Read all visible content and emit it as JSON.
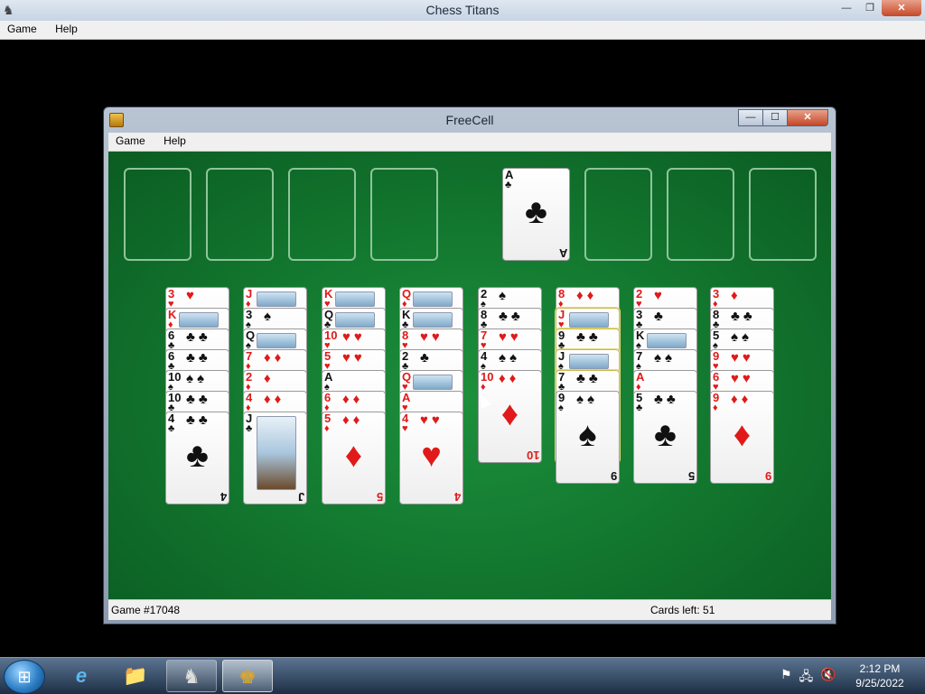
{
  "bg_window": {
    "title": "Chess Titans",
    "menu": [
      "Game",
      "Help"
    ],
    "controls": {
      "minimize": "—",
      "restore": "❐",
      "close": "✕"
    }
  },
  "freecell": {
    "title": "FreeCell",
    "menu": [
      "Game",
      "Help"
    ],
    "controls": {
      "minimize": "—",
      "maximize": "☐",
      "close": "✕"
    },
    "foundation": [
      {
        "rank": "A",
        "suit": "♣",
        "color": "black"
      }
    ],
    "columns": [
      [
        {
          "r": "3",
          "s": "♥",
          "c": "red"
        },
        {
          "r": "K",
          "s": "♦",
          "c": "red"
        },
        {
          "r": "6",
          "s": "♣",
          "c": "black"
        },
        {
          "r": "6",
          "s": "♣",
          "c": "black"
        },
        {
          "r": "10",
          "s": "♠",
          "c": "black"
        },
        {
          "r": "10",
          "s": "♣",
          "c": "black"
        },
        {
          "r": "4",
          "s": "♣",
          "c": "black"
        }
      ],
      [
        {
          "r": "J",
          "s": "♦",
          "c": "red"
        },
        {
          "r": "3",
          "s": "♠",
          "c": "black"
        },
        {
          "r": "Q",
          "s": "♠",
          "c": "black"
        },
        {
          "r": "7",
          "s": "♦",
          "c": "red"
        },
        {
          "r": "2",
          "s": "♦",
          "c": "red"
        },
        {
          "r": "4",
          "s": "♦",
          "c": "red"
        },
        {
          "r": "J",
          "s": "♣",
          "c": "black"
        }
      ],
      [
        {
          "r": "K",
          "s": "♥",
          "c": "red"
        },
        {
          "r": "Q",
          "s": "♣",
          "c": "black"
        },
        {
          "r": "10",
          "s": "♥",
          "c": "red"
        },
        {
          "r": "5",
          "s": "♥",
          "c": "red"
        },
        {
          "r": "A",
          "s": "♠",
          "c": "black"
        },
        {
          "r": "6",
          "s": "♦",
          "c": "red"
        },
        {
          "r": "5",
          "s": "♦",
          "c": "red"
        }
      ],
      [
        {
          "r": "Q",
          "s": "♦",
          "c": "red"
        },
        {
          "r": "K",
          "s": "♣",
          "c": "black"
        },
        {
          "r": "8",
          "s": "♥",
          "c": "red"
        },
        {
          "r": "2",
          "s": "♣",
          "c": "black"
        },
        {
          "r": "Q",
          "s": "♥",
          "c": "red"
        },
        {
          "r": "A",
          "s": "♥",
          "c": "red"
        },
        {
          "r": "4",
          "s": "♥",
          "c": "red"
        }
      ],
      [
        {
          "r": "2",
          "s": "♠",
          "c": "black"
        },
        {
          "r": "8",
          "s": "♣",
          "c": "black"
        },
        {
          "r": "7",
          "s": "♥",
          "c": "red"
        },
        {
          "r": "4",
          "s": "♠",
          "c": "black"
        },
        {
          "r": "10",
          "s": "♦",
          "c": "red"
        }
      ],
      [
        {
          "r": "8",
          "s": "♦",
          "c": "red"
        },
        {
          "r": "J",
          "s": "♥",
          "c": "red"
        },
        {
          "r": "9",
          "s": "♣",
          "c": "black"
        },
        {
          "r": "J",
          "s": "♠",
          "c": "black"
        },
        {
          "r": "7",
          "s": "♣",
          "c": "black"
        },
        {
          "r": "9",
          "s": "♠",
          "c": "black"
        }
      ],
      [
        {
          "r": "2",
          "s": "♥",
          "c": "red"
        },
        {
          "r": "3",
          "s": "♣",
          "c": "black"
        },
        {
          "r": "K",
          "s": "♠",
          "c": "black"
        },
        {
          "r": "7",
          "s": "♠",
          "c": "black"
        },
        {
          "r": "A",
          "s": "♦",
          "c": "red"
        },
        {
          "r": "5",
          "s": "♣",
          "c": "black"
        }
      ],
      [
        {
          "r": "3",
          "s": "♦",
          "c": "red"
        },
        {
          "r": "8",
          "s": "♣",
          "c": "black"
        },
        {
          "r": "5",
          "s": "♠",
          "c": "black"
        },
        {
          "r": "9",
          "s": "♥",
          "c": "red"
        },
        {
          "r": "6",
          "s": "♥",
          "c": "red"
        },
        {
          "r": "9",
          "s": "♦",
          "c": "red"
        }
      ]
    ],
    "status": {
      "game": "Game #17048",
      "cards_left": "Cards left: 51"
    }
  },
  "colors": {
    "felt": "#137a30",
    "red_suit": "#e01a1a",
    "black_suit": "#111111",
    "slot_border": "#8fc49a"
  },
  "taskbar": {
    "items": [
      {
        "name": "internet-explorer-icon",
        "glyph": "e"
      },
      {
        "name": "file-explorer-icon",
        "glyph": "📁"
      },
      {
        "name": "chess-titans-icon",
        "glyph": "♞"
      },
      {
        "name": "freecell-icon",
        "glyph": "♚"
      }
    ],
    "tray_icons": [
      "action-center-flag-icon",
      "network-icon",
      "volume-muted-icon"
    ],
    "clock": {
      "time": "2:12 PM",
      "date": "9/25/2022"
    }
  }
}
